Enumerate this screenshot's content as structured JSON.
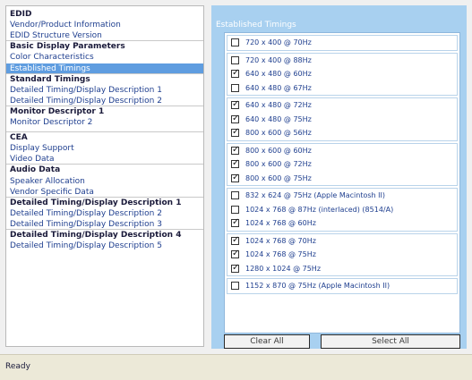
{
  "left_panel": {
    "rows": [
      {
        "text": "EDID",
        "kind": "head"
      },
      {
        "text": "Vendor/Product Information",
        "kind": "item"
      },
      {
        "text": "EDID Structure Version",
        "kind": "item"
      },
      {
        "text": "Basic Display Parameters",
        "kind": "head"
      },
      {
        "text": "Color Characteristics",
        "kind": "item"
      },
      {
        "text": "Established Timings",
        "kind": "selected"
      },
      {
        "text": "Standard Timings",
        "kind": "head"
      },
      {
        "text": "Detailed Timing/Display Description 1",
        "kind": "item"
      },
      {
        "text": "Detailed Timing/Display Description 2",
        "kind": "item"
      },
      {
        "text": "Monitor Descriptor 1",
        "kind": "head"
      },
      {
        "text": "Monitor Descriptor 2",
        "kind": "item"
      },
      {
        "text": "CEA",
        "kind": "head"
      },
      {
        "text": "Display Support",
        "kind": "item"
      },
      {
        "text": "Video Data",
        "kind": "item"
      },
      {
        "text": "Audio Data",
        "kind": "head"
      },
      {
        "text": "Speaker Allocation",
        "kind": "item"
      },
      {
        "text": "Vendor Specific Data",
        "kind": "item"
      },
      {
        "text": "Detailed Timing/Display Description 1",
        "kind": "head"
      },
      {
        "text": "Detailed Timing/Display Description 2",
        "kind": "item"
      },
      {
        "text": "Detailed Timing/Display Description 3",
        "kind": "item"
      },
      {
        "text": "Detailed Timing/Display Description 4",
        "kind": "head"
      },
      {
        "text": "Detailed Timing/Display Description 5",
        "kind": "item"
      }
    ]
  },
  "right_panel": {
    "title": "Established Timings",
    "groups": [
      {
        "items": [
          {
            "label": "720 x 400 @ 70Hz",
            "checked": false
          }
        ]
      },
      {
        "items": [
          {
            "label": "720 x 400 @ 88Hz",
            "checked": false
          },
          {
            "label": "640 x 480 @ 60Hz",
            "checked": true
          },
          {
            "label": "640 x 480 @ 67Hz",
            "checked": false
          }
        ]
      },
      {
        "items": [
          {
            "label": "640 x 480 @ 72Hz",
            "checked": true
          },
          {
            "label": "640 x 480 @ 75Hz",
            "checked": true
          },
          {
            "label": "800 x 600 @ 56Hz",
            "checked": true
          }
        ]
      },
      {
        "items": [
          {
            "label": "800 x 600 @ 60Hz",
            "checked": true
          },
          {
            "label": "800 x 600 @ 72Hz",
            "checked": true
          },
          {
            "label": "800 x 600 @ 75Hz",
            "checked": true
          }
        ]
      },
      {
        "items": [
          {
            "label": "832 x 624 @ 75Hz (Apple Macintosh II)",
            "checked": false
          },
          {
            "label": "1024 x 768 @ 87Hz (interlaced) (8514/A)",
            "checked": false
          },
          {
            "label": "1024 x 768 @ 60Hz",
            "checked": true
          }
        ]
      },
      {
        "items": [
          {
            "label": "1024 x 768 @ 70Hz",
            "checked": true
          },
          {
            "label": "1024 x 768 @ 75Hz",
            "checked": true
          },
          {
            "label": "1280 x 1024 @ 75Hz",
            "checked": true
          }
        ]
      },
      {
        "items": [
          {
            "label": "1152 x 870 @ 75Hz (Apple Macintosh II)",
            "checked": false
          }
        ]
      }
    ],
    "clear_all_label": "Clear All",
    "select_all_label": "Select All"
  },
  "status_bar": {
    "text": "Ready"
  }
}
